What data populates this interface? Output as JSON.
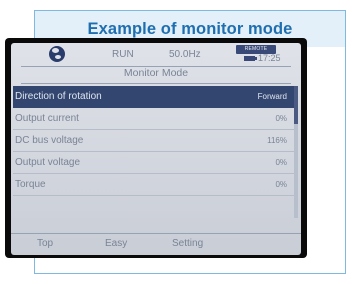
{
  "caption": "Example of monitor mode",
  "status": {
    "run_state": "RUN",
    "frequency": "50.0Hz",
    "badge_text": "REMOTE",
    "time": "17:25",
    "icons": [
      "globe-icon",
      "battery-icon"
    ]
  },
  "screen_title": "Monitor Mode",
  "rows": [
    {
      "label": "Direction of rotation",
      "value": "Forward",
      "selected": true
    },
    {
      "label": "Output current",
      "value": "0%"
    },
    {
      "label": "DC bus voltage",
      "value": "116%"
    },
    {
      "label": "Output voltage",
      "value": "0%"
    },
    {
      "label": "Torque",
      "value": "0%"
    }
  ],
  "softkeys": [
    "Top",
    "Easy",
    "Setting"
  ],
  "colors": {
    "caption_text": "#1f6fb0",
    "caption_bg": "#e3f0fa",
    "selection_bg": "#33466f",
    "lcd_bg": "#d9dce3"
  }
}
